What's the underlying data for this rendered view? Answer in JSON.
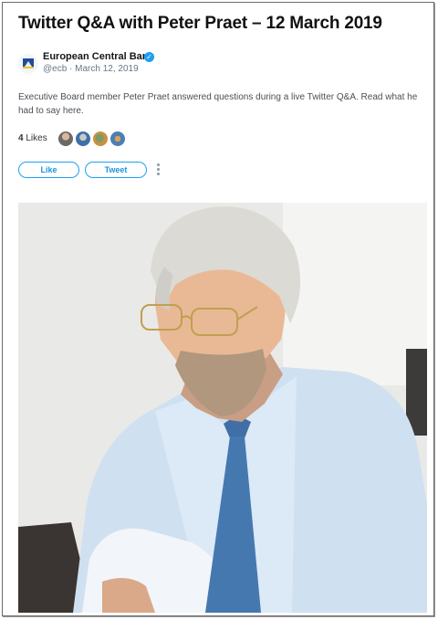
{
  "page": {
    "title": "Twitter Q&A with Peter Praet – 12 March 2019"
  },
  "tweet": {
    "author_name": "European Central Bank",
    "handle_date": "@ecb · March 12, 2019",
    "verified_icon": "verified-badge-icon",
    "text": "Executive Board member Peter Praet answered questions during a live Twitter Q&A. Read what he had to say here.",
    "likes_count": "4",
    "likes_label": "Likes",
    "like_button": "Like",
    "tweet_button": "Tweet",
    "more_icon": "vertical-ellipsis-icon"
  },
  "colors": {
    "accent": "#1da1f2",
    "text": "#14171a",
    "muted": "#657786"
  }
}
